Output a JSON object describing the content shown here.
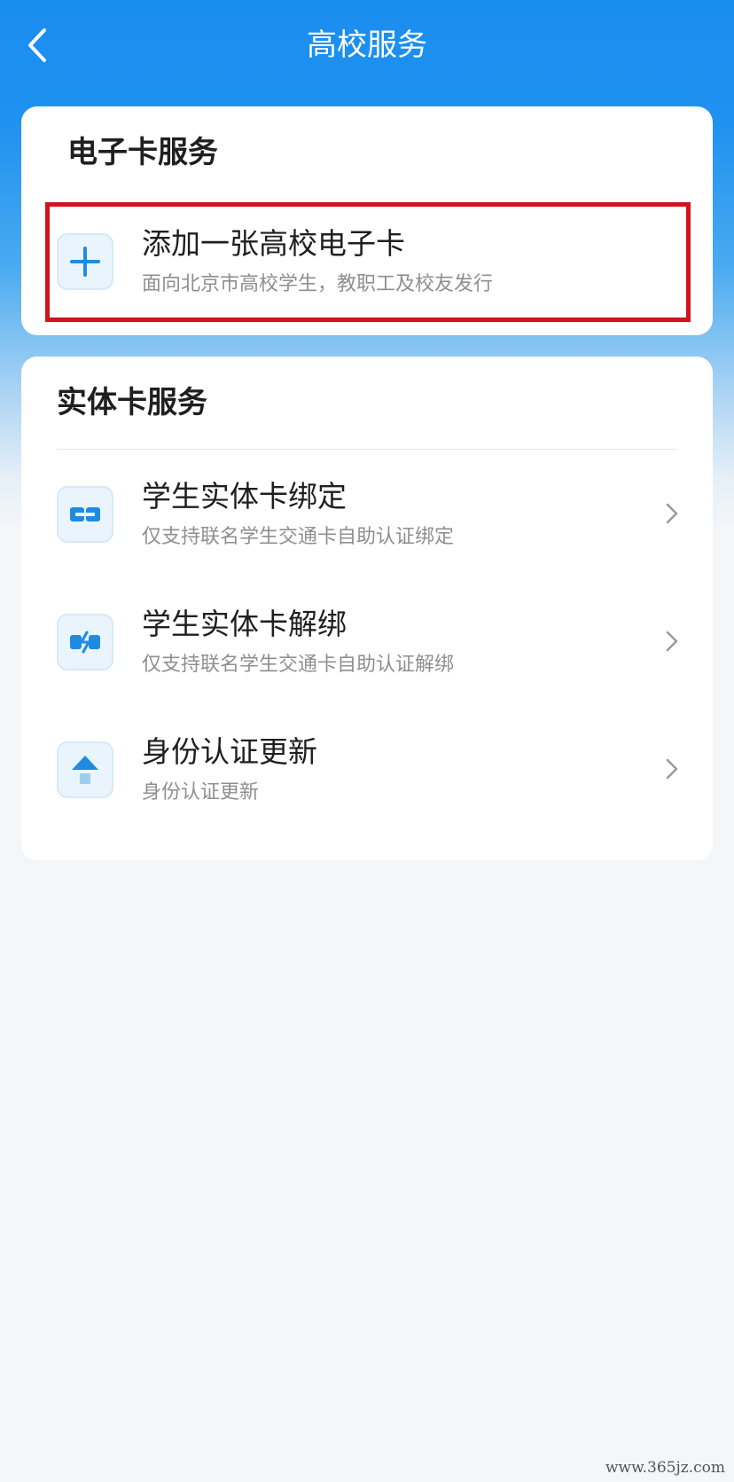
{
  "header": {
    "title": "高校服务",
    "back_icon": "chevron-left-icon"
  },
  "electronic_card": {
    "section_title": "电子卡服务",
    "items": [
      {
        "title": "添加一张高校电子卡",
        "subtitle": "面向北京市高校学生，教职工及校友发行",
        "icon": "plus-icon"
      }
    ]
  },
  "physical_card": {
    "section_title": "实体卡服务",
    "items": [
      {
        "title": "学生实体卡绑定",
        "subtitle": "仅支持联名学生交通卡自助认证绑定",
        "icon": "link-icon"
      },
      {
        "title": "学生实体卡解绑",
        "subtitle": "仅支持联名学生交通卡自助认证解绑",
        "icon": "unlink-icon"
      },
      {
        "title": "身份认证更新",
        "subtitle": "身份认证更新",
        "icon": "upload-icon"
      }
    ]
  },
  "watermark": "www.365jz.com",
  "colors": {
    "accent": "#1a8df0",
    "highlight_border": "#d0141c"
  }
}
